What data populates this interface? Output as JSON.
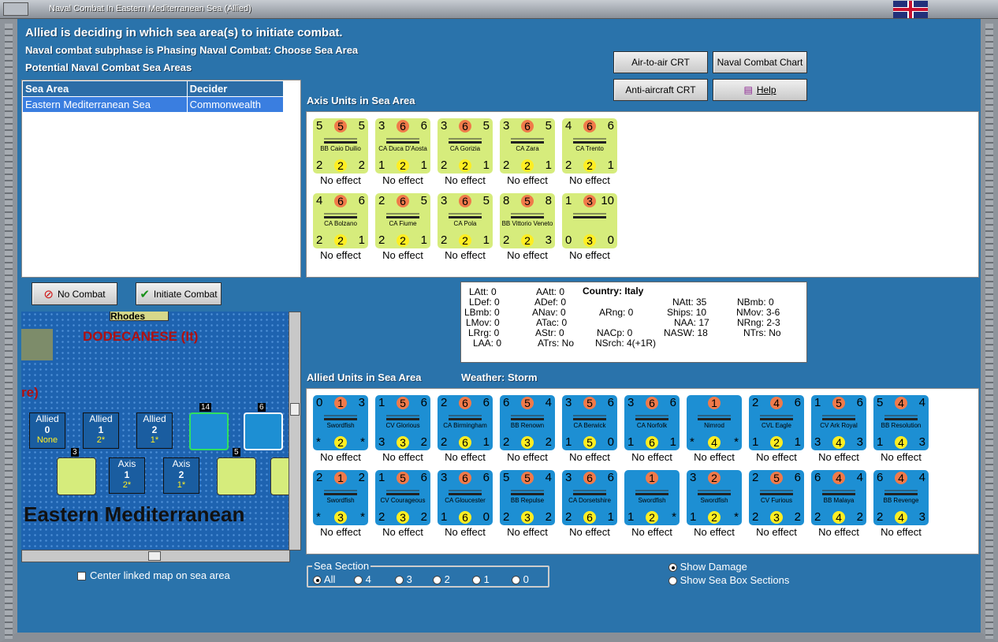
{
  "window": {
    "title": "Naval Combat In Eastern Mediterranean Sea (Allied)"
  },
  "header": {
    "line1": "Allied is deciding in which sea area(s) to initiate combat.",
    "line2": "Naval combat subphase is Phasing Naval Combat: Choose Sea Area",
    "line3": "Potential Naval Combat Sea Areas"
  },
  "buttons": {
    "air_to_air": "Air-to-air CRT",
    "naval_chart": "Naval Combat Chart",
    "anti_aircraft": "Anti-aircraft CRT",
    "help": "Help",
    "no_combat": "No Combat",
    "initiate": "Initiate Combat"
  },
  "sea_table": {
    "col1": "Sea Area",
    "col2": "Decider",
    "row_area": "Eastern Mediterranean Sea",
    "row_decider": "Commonwealth"
  },
  "axis_title": "Axis Units in Sea Area",
  "allied_title": "Allied Units in Sea Area",
  "weather": "Weather:  Storm",
  "effect": "No effect",
  "axis_units": [
    {
      "name": "BB Caio Duilio",
      "tl": "5",
      "tc": "5",
      "tr": "5",
      "bl": "2",
      "bc": "2",
      "br": "2"
    },
    {
      "name": "CA Duca D'Aosta",
      "tl": "3",
      "tc": "6",
      "tr": "6",
      "bl": "1",
      "bc": "2",
      "br": "1"
    },
    {
      "name": "CA Gorizia",
      "tl": "3",
      "tc": "6",
      "tr": "5",
      "bl": "2",
      "bc": "2",
      "br": "1"
    },
    {
      "name": "CA Zara",
      "tl": "3",
      "tc": "6",
      "tr": "5",
      "bl": "2",
      "bc": "2",
      "br": "1"
    },
    {
      "name": "CA Trento",
      "tl": "4",
      "tc": "6",
      "tr": "6",
      "bl": "2",
      "bc": "2",
      "br": "1"
    },
    {
      "name": "CA Bolzano",
      "tl": "4",
      "tc": "6",
      "tr": "6",
      "bl": "2",
      "bc": "2",
      "br": "1"
    },
    {
      "name": "CA Fiume",
      "tl": "2",
      "tc": "6",
      "tr": "5",
      "bl": "2",
      "bc": "2",
      "br": "1"
    },
    {
      "name": "CA Pola",
      "tl": "3",
      "tc": "6",
      "tr": "5",
      "bl": "2",
      "bc": "2",
      "br": "1"
    },
    {
      "name": "BB Vittorio Veneto",
      "tl": "8",
      "tc": "5",
      "tr": "8",
      "bl": "2",
      "bc": "2",
      "br": "3"
    },
    {
      "name": "",
      "tl": "1",
      "tc": "3",
      "tr": "10",
      "bl": "0",
      "bc": "3",
      "br": "0"
    }
  ],
  "allied_units": [
    {
      "name": "Swordfish",
      "tl": "0",
      "tc": "1",
      "tr": "3",
      "bl": "*",
      "bc": "2",
      "br": "*"
    },
    {
      "name": "CV Glorious",
      "tl": "1",
      "tc": "5",
      "tr": "6",
      "bl": "3",
      "bc": "3",
      "br": "2"
    },
    {
      "name": "CA Birmingham",
      "tl": "2",
      "tc": "6",
      "tr": "6",
      "bl": "2",
      "bc": "6",
      "br": "1"
    },
    {
      "name": "BB Renown",
      "tl": "6",
      "tc": "5",
      "tr": "4",
      "bl": "2",
      "bc": "3",
      "br": "2"
    },
    {
      "name": "CA Berwick",
      "tl": "3",
      "tc": "5",
      "tr": "6",
      "bl": "1",
      "bc": "5",
      "br": "0"
    },
    {
      "name": "CA Norfolk",
      "tl": "3",
      "tc": "6",
      "tr": "6",
      "bl": "1",
      "bc": "6",
      "br": "1"
    },
    {
      "name": "Nimrod",
      "tl": "",
      "tc": "1",
      "tr": "",
      "bl": "*",
      "bc": "4",
      "br": "*"
    },
    {
      "name": "CVL Eagle",
      "tl": "2",
      "tc": "4",
      "tr": "6",
      "bl": "1",
      "bc": "2",
      "br": "1"
    },
    {
      "name": "CV Ark Royal",
      "tl": "1",
      "tc": "5",
      "tr": "6",
      "bl": "3",
      "bc": "4",
      "br": "3"
    },
    {
      "name": "BB Resolution",
      "tl": "5",
      "tc": "4",
      "tr": "4",
      "bl": "1",
      "bc": "4",
      "br": "3"
    },
    {
      "name": "Swordfish",
      "tl": "2",
      "tc": "1",
      "tr": "2",
      "bl": "*",
      "bc": "3",
      "br": "*"
    },
    {
      "name": "CV Courageous",
      "tl": "1",
      "tc": "5",
      "tr": "6",
      "bl": "2",
      "bc": "3",
      "br": "2"
    },
    {
      "name": "CA Gloucester",
      "tl": "3",
      "tc": "6",
      "tr": "6",
      "bl": "1",
      "bc": "6",
      "br": "0"
    },
    {
      "name": "BB Repulse",
      "tl": "5",
      "tc": "5",
      "tr": "4",
      "bl": "2",
      "bc": "3",
      "br": "2"
    },
    {
      "name": "CA Dorsetshire",
      "tl": "3",
      "tc": "6",
      "tr": "6",
      "bl": "2",
      "bc": "6",
      "br": "1"
    },
    {
      "name": "Swordfish",
      "tl": "",
      "tc": "1",
      "tr": "",
      "bl": "1",
      "bc": "2",
      "br": "*"
    },
    {
      "name": "Swordfish",
      "tl": "3",
      "tc": "2",
      "tr": "",
      "bl": "1",
      "bc": "2",
      "br": "*"
    },
    {
      "name": "CV Furious",
      "tl": "2",
      "tc": "5",
      "tr": "6",
      "bl": "2",
      "bc": "3",
      "br": "2"
    },
    {
      "name": "BB Malaya",
      "tl": "6",
      "tc": "4",
      "tr": "4",
      "bl": "2",
      "bc": "4",
      "br": "2"
    },
    {
      "name": "BB Revenge",
      "tl": "6",
      "tc": "4",
      "tr": "4",
      "bl": "2",
      "bc": "4",
      "br": "3"
    }
  ],
  "stats": {
    "country_label": "Country: Italy",
    "latt": "LAtt: 0",
    "ldef": "LDef: 0",
    "lbmb": "LBmb: 0",
    "lmov": "LMov: 0",
    "lrg": "LRrg: 0",
    "laa": "LAA: 0",
    "aatt": "AAtt: 0",
    "adef": "ADef: 0",
    "anav": "ANav: 0",
    "atac": "ATac: 0",
    "astr": "AStr: 0",
    "atrs": "ATrs: No",
    "arng": "ARng: 0",
    "nacp": "NACp: 0",
    "nsrch": "NSrch: 4(+1R)",
    "natt": "NAtt: 35",
    "ships": "Ships: 10",
    "naa": "NAA: 17",
    "nasw": "NASW: 18",
    "nbmb": "NBmb: 0",
    "nmov": "NMov: 3-6",
    "nrng": "NRng: 2-3",
    "ntrs": "NTrs: No"
  },
  "map": {
    "dodecanese": "DODECANESE (It)",
    "rhodes": "Rhodes",
    "re": "re)",
    "sea_name": "Eastern Mediterranean",
    "allied_boxes": [
      {
        "t": "Allied",
        "n": "0",
        "s": "None"
      },
      {
        "t": "Allied",
        "n": "1",
        "s": "2*"
      },
      {
        "t": "Allied",
        "n": "2",
        "s": "1*"
      }
    ],
    "axis_boxes": [
      {
        "t": "Axis",
        "n": "1",
        "s": "2*"
      },
      {
        "t": "Axis",
        "n": "2",
        "s": "1*"
      }
    ],
    "stack_counts": [
      "14",
      "6",
      "3",
      "5"
    ]
  },
  "center_linked": "Center linked map on sea area",
  "sea_section": {
    "title": "Sea Section",
    "options": [
      "All",
      "4",
      "3",
      "2",
      "1",
      "0"
    ]
  },
  "show_damage": "Show Damage",
  "show_sections": "Show Sea Box Sections",
  "colors": {
    "attack": "#f07a4a",
    "defense": "#ffee22",
    "blue_box": "#5aa8f0"
  }
}
